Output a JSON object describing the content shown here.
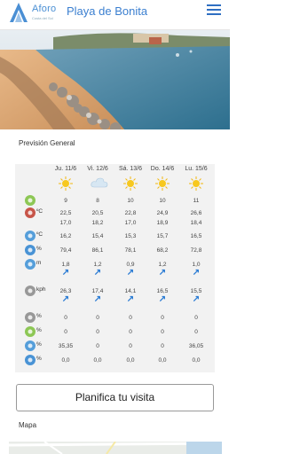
{
  "header": {
    "logo_text": "Aforo",
    "logo_sub": "Costa del Sol",
    "title": "Playa de Bonita"
  },
  "forecast": {
    "section_title": "Previsión General",
    "days": [
      "Ju. 11/6",
      "Vi. 12/6",
      "Sá. 13/6",
      "Do. 14/6",
      "Lu. 15/6"
    ],
    "day_icons": [
      "sun-icon",
      "cloudy-icon",
      "sun-icon",
      "sun-icon",
      "sun-icon"
    ],
    "rows": [
      {
        "icon": "uv-index-icon",
        "unit": "",
        "values": [
          "9",
          "8",
          "10",
          "10",
          "11"
        ]
      },
      {
        "icon": "thermometer-minmax-icon",
        "unit": "ºC",
        "values": [
          "22,5\n17,0",
          "20,5\n18,2",
          "22,8\n17,0",
          "24,9\n18,9",
          "26,6\n18,4"
        ]
      },
      {
        "icon": "water-temp-icon",
        "unit": "ºC",
        "values": [
          "16,2",
          "15,4",
          "15,3",
          "15,7",
          "16,5"
        ]
      },
      {
        "icon": "humidity-icon",
        "unit": "%",
        "values": [
          "79,4",
          "86,1",
          "78,1",
          "68,2",
          "72,8"
        ]
      },
      {
        "icon": "wave-icon",
        "unit": "m",
        "values": [
          "1,8",
          "1,2",
          "0,9",
          "1,2",
          "1,0"
        ]
      },
      {
        "icon": "wind-icon",
        "unit": "kph",
        "values": [
          "26,3",
          "17,4",
          "14,1",
          "16,5",
          "15,5"
        ]
      },
      {
        "icon": "cloud-cover-icon",
        "unit": "%",
        "values": [
          "0",
          "0",
          "0",
          "0",
          "0"
        ]
      },
      {
        "icon": "rain-prob-icon",
        "unit": "%",
        "values": [
          "0",
          "0",
          "0",
          "0",
          "0"
        ]
      },
      {
        "icon": "occupancy-icon",
        "unit": "%",
        "values": [
          "35,35",
          "0",
          "0",
          "0",
          "36,05"
        ]
      },
      {
        "icon": "precipitation-icon",
        "unit": "%",
        "values": [
          "0,0",
          "0,0",
          "0,0",
          "0,0",
          "0,0"
        ]
      }
    ]
  },
  "cta": {
    "label": "Planifica tu visita"
  },
  "map": {
    "section_title": "Mapa"
  },
  "colors": {
    "accent": "#3b7fd0",
    "arrow": "#2a7bd4",
    "table_bg": "#f2f2f2"
  }
}
